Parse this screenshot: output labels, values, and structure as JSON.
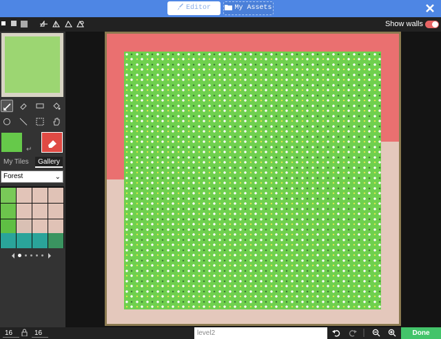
{
  "header": {
    "tabs": [
      {
        "label": "Editor",
        "icon": "brush-icon",
        "active": true
      },
      {
        "label": "My Assets",
        "icon": "folder-icon",
        "active": false
      }
    ],
    "close_icon": "close-icon",
    "color": "#4e86e4"
  },
  "toolbar": {
    "show_walls_label": "Show walls",
    "show_walls_on": true
  },
  "sidebar": {
    "tabs": [
      {
        "label": "My Tiles",
        "active": false
      },
      {
        "label": "Gallery",
        "active": true
      }
    ],
    "category_value": "Forest"
  },
  "bottom": {
    "width_value": "16",
    "height_value": "16",
    "level_name_placeholder": "level2",
    "done_label": "Done"
  }
}
